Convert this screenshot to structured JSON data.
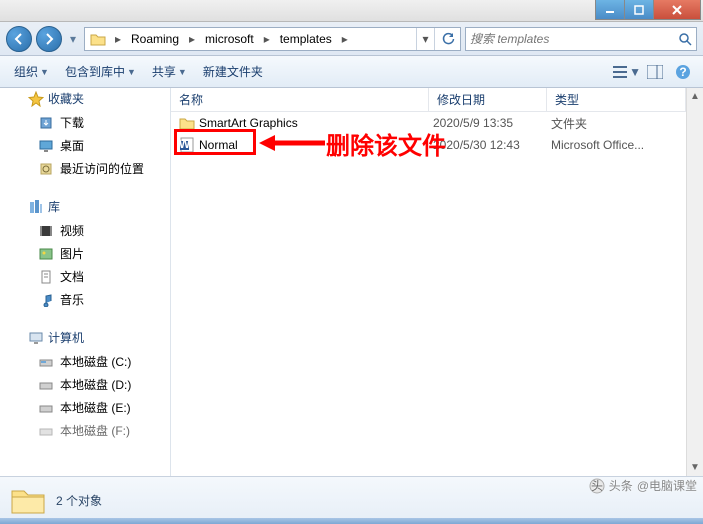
{
  "titlebar": {
    "title": ""
  },
  "nav": {
    "breadcrumb": [
      "Roaming",
      "microsoft",
      "templates"
    ]
  },
  "search": {
    "placeholder": "搜索 templates"
  },
  "toolbar": {
    "organize": "组织",
    "include": "包含到库中",
    "share": "共享",
    "newfolder": "新建文件夹"
  },
  "columns": {
    "name": "名称",
    "date": "修改日期",
    "type": "类型"
  },
  "files": [
    {
      "name": "SmartArt Graphics",
      "date": "2020/5/9 13:35",
      "type": "文件夹",
      "kind": "folder"
    },
    {
      "name": "Normal",
      "date": "2020/5/30 12:43",
      "type": "Microsoft Office...",
      "kind": "word"
    }
  ],
  "sidebar": {
    "favorites": {
      "label": "收藏夹",
      "items": [
        "下载",
        "桌面",
        "最近访问的位置"
      ]
    },
    "libraries": {
      "label": "库",
      "items": [
        "视频",
        "图片",
        "文档",
        "音乐"
      ]
    },
    "computer": {
      "label": "计算机",
      "items": [
        "本地磁盘 (C:)",
        "本地磁盘 (D:)",
        "本地磁盘 (E:)",
        "本地磁盘 (F:)"
      ]
    }
  },
  "status": {
    "count_label": "2 个对象"
  },
  "annotation": {
    "text": "删除该文件"
  },
  "watermark": {
    "prefix": "头条",
    "text": "@电脑课堂"
  }
}
